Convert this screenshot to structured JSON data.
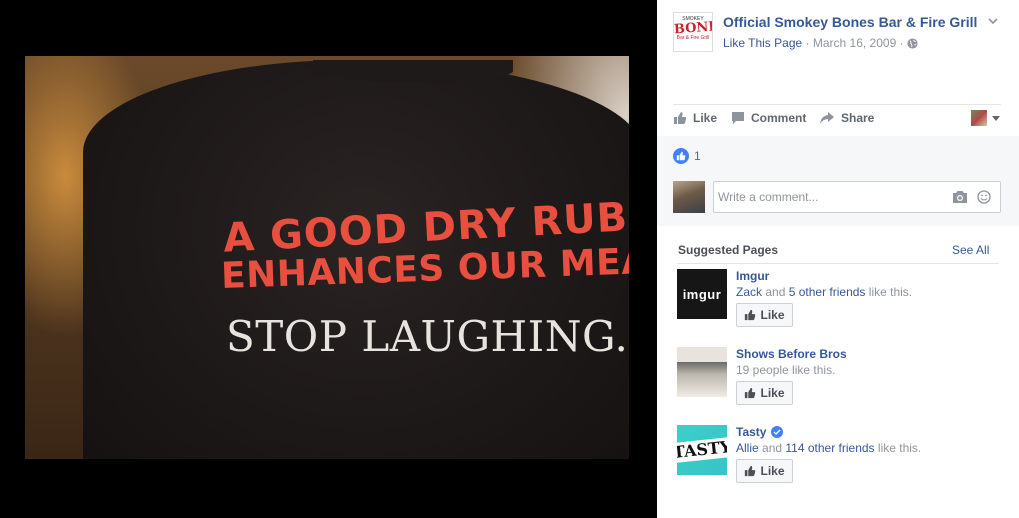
{
  "photo": {
    "shirt_text": {
      "line1": "A GOOD DRY RUB",
      "line2": "ENHANCES OUR MEAT.",
      "line3": "STOP LAUGHING."
    }
  },
  "post": {
    "page_name": "Official Smokey Bones Bar & Fire Grill",
    "logo_text": {
      "top": "SMOKEY",
      "main": "BONES",
      "sub": "Bar & Fire Grill"
    },
    "like_page": "Like This Page",
    "separator": "·",
    "date": "March 16, 2009",
    "chevron_icon": "chevron-down-icon",
    "privacy_icon": "globe-icon"
  },
  "actions": {
    "like": "Like",
    "comment": "Comment",
    "share": "Share"
  },
  "reactions": {
    "count": "1"
  },
  "comment": {
    "placeholder": "Write a comment..."
  },
  "suggested": {
    "title": "Suggested Pages",
    "see_all": "See All",
    "items": [
      {
        "name": "Imgur",
        "thumb_text": "imgur",
        "friend": "Zack",
        "and": " and ",
        "others": "5 other friends",
        "suffix": " like this.",
        "like_label": "Like"
      },
      {
        "name": "Shows Before Bros",
        "desc": "19 people like this.",
        "like_label": "Like"
      },
      {
        "name": "Tasty",
        "thumb_text": "TASTY",
        "verified": true,
        "friend": "Allie",
        "and": " and ",
        "others": "114 other friends",
        "suffix": " like this.",
        "like_label": "Like"
      }
    ]
  },
  "colors": {
    "link_blue": "#365899",
    "like_blue": "#4080ff",
    "shirt_red": "#e94f3f"
  }
}
